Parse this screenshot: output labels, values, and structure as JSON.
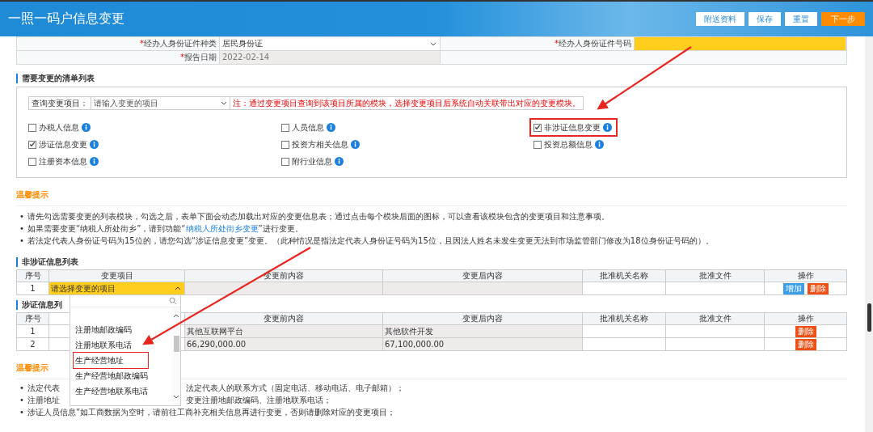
{
  "header": {
    "title": "一照一码户信息变更",
    "buttons": [
      {
        "label": "附送资料",
        "kind": "secondary"
      },
      {
        "label": "保存",
        "kind": "secondary"
      },
      {
        "label": "重置",
        "kind": "secondary"
      },
      {
        "label": "下一步",
        "kind": "primary"
      }
    ]
  },
  "form": {
    "rows": [
      {
        "fields": [
          {
            "mark": "*",
            "label": "经办人身份证件种类",
            "kind": "select",
            "value": "居民身份证"
          },
          {
            "mark": "*",
            "label": "经办人身份证件号码",
            "kind": "input",
            "highlighted": true
          }
        ]
      },
      {
        "fields": [
          {
            "mark": "*",
            "label": "报告日期",
            "kind": "readonly",
            "value": "2022-02-14"
          }
        ]
      }
    ]
  },
  "change_list": {
    "title": "需要变更的清单列表",
    "query": {
      "label": "查询变更项目：",
      "placeholder": "请输入变更的项目",
      "note": "注：通过变更项目查询到该项目所属的模块，选择变更项目后系统自动关联带出对应的变更模块。"
    },
    "modules": [
      {
        "label": "办税人信息",
        "checked": false
      },
      {
        "label": "人员信息",
        "checked": false
      },
      {
        "label": "非涉证信息变更",
        "checked": true,
        "annotated": true
      },
      {
        "label": "涉证信息变更",
        "checked": true
      },
      {
        "label": "投资方相关信息",
        "checked": false
      },
      {
        "label": "投资总额信息",
        "checked": false
      },
      {
        "label": "注册资本信息",
        "checked": false
      },
      {
        "label": "附行业信息",
        "checked": false
      }
    ]
  },
  "tips": {
    "title": "温馨提示",
    "bullet": "•",
    "items": [
      [
        {
          "kind": "text",
          "text": "请先勾选需要变更的列表模块，勾选之后，表单下面会动态加载出对应的变更信息表；通过点击每个模块后面的图标，可以查看该模块包含的变更项目和注意事项。"
        }
      ],
      [
        {
          "kind": "text",
          "text": "如果需要变更“纳税人所处街乡”，请到功能“"
        },
        {
          "kind": "link",
          "text": "纳税人所处街乡变更"
        },
        {
          "kind": "text",
          "text": "”进行变更。"
        }
      ],
      [
        {
          "kind": "text",
          "text": "若法定代表人身份证号码为15位的，请您勾选“涉证信息变更”变更。（此种情况是指法定代表人身份证号码为15位，且因法人姓名未发生变更无法到市场监管部门修改为18位身份证号码的）。"
        }
      ]
    ]
  },
  "non_license_table": {
    "title": "非涉证信息列表",
    "columns": [
      "序号",
      "变更项目",
      "变更前内容",
      "变更后内容",
      "批准机关名称",
      "批准文件",
      "操作"
    ],
    "rows": [
      {
        "index": "1",
        "item_placeholder": "请选择变更的项目",
        "actions": [
          {
            "label": "增加",
            "kind": "add"
          },
          {
            "label": "删除",
            "kind": "delete"
          }
        ]
      }
    ]
  },
  "dropdown": {
    "open": true,
    "options": [
      {
        "label": "注册地邮政编码"
      },
      {
        "label": "注册地联系电话"
      },
      {
        "label": "生产经营地址",
        "highlighted": true
      },
      {
        "label": "生产经营地邮政编码"
      },
      {
        "label": "生产经营地联系电话"
      }
    ]
  },
  "license_table": {
    "title": "涉证信息列",
    "columns": [
      "序号",
      "变更前内容",
      "变更后内容",
      "批准机关名称",
      "批准文件",
      "操作"
    ],
    "rows": [
      {
        "index": "1",
        "before": "其他互联网平台",
        "after": "其他软件开发",
        "actions": [
          {
            "label": "删除",
            "kind": "delete"
          }
        ]
      },
      {
        "index": "2",
        "before": "66,290,000.00",
        "after": "67,100,000.00",
        "actions": [
          {
            "label": "删除",
            "kind": "delete"
          }
        ]
      }
    ]
  },
  "tips2": {
    "title": "温馨提示",
    "bullet": "•",
    "items": [
      [
        "法定代表",
        "法定代表人的联系方式（固定电话、移动电话、电子邮箱）；"
      ],
      [
        "注册地址",
        "变更注册地邮政编码、注册地联系电话；"
      ],
      [
        "涉证人员信息”如工商数据为空时，请前往工商补充相关信息再进行变更，否则请删除对应的变更项目；"
      ]
    ]
  }
}
